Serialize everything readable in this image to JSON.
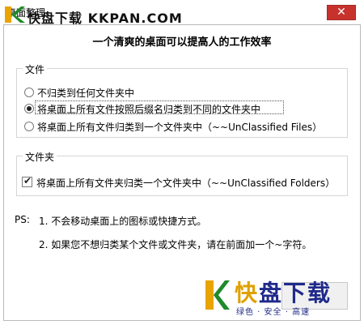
{
  "window": {
    "title": "桌面整理"
  },
  "watermark_top": {
    "text": "快盘下载 KKPAN.COM"
  },
  "header": {
    "title": "一个清爽的桌面可以提高人的工作效率"
  },
  "files_group": {
    "label": "文件",
    "options": [
      {
        "label": "不归类到任何文件夹中",
        "selected": false
      },
      {
        "label": "将桌面上所有文件按照后缀名归类到不同的文件夹中",
        "selected": true
      },
      {
        "label": "将桌面上所有文件归类到一个文件夹中（~~UnClassified Files）",
        "selected": false
      }
    ]
  },
  "folders_group": {
    "label": "文件夹",
    "checkbox": {
      "label": "将桌面上所有文件夹归类一个文件夹中（~~UnClassified Folders）",
      "checked": true
    }
  },
  "ps": {
    "prefix": "PS:",
    "notes": [
      "1. 不会移动桌面上的图标或快捷方式。",
      "2. 如果您不想归类某个文件或文件夹，请在前面加一个~字符。"
    ]
  },
  "watermark_bottom": {
    "brand_first": "快",
    "brand_rest": "盘下载",
    "tagline": "绿色 · 安全 · 高速"
  },
  "colors": {
    "close": "#c7322d",
    "brand_blue": "#1f2a8a",
    "brand_orange": "#e0a000"
  }
}
